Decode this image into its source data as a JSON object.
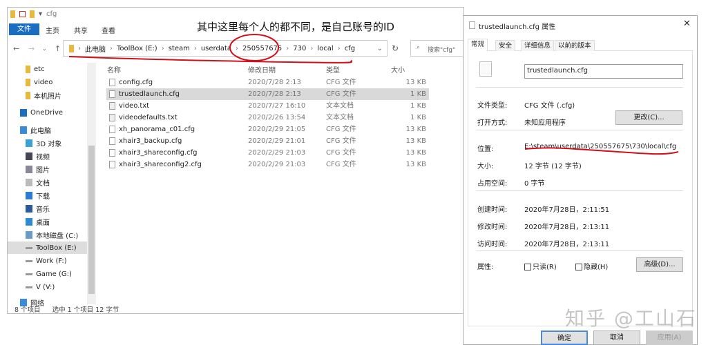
{
  "explorer": {
    "title": "cfg",
    "ribbon_tabs": [
      "文件",
      "主页",
      "共享",
      "查看"
    ],
    "breadcrumb": [
      "此电脑",
      "ToolBox (E:)",
      "steam",
      "userdata",
      "250557675",
      "730",
      "local",
      "cfg"
    ],
    "search_placeholder": "搜索\"cfg\"",
    "sidebar": [
      "etc",
      "video",
      "本机照片",
      "OneDrive",
      "此电脑",
      "3D 对象",
      "视频",
      "图片",
      "文档",
      "下载",
      "音乐",
      "桌面",
      "本地磁盘 (C:)",
      "ToolBox (E:)",
      "Work (F:)",
      "Game (G:)",
      "V (V:)",
      "网络"
    ],
    "columns": [
      "名称",
      "修改日期",
      "类型",
      "大小"
    ],
    "files": [
      {
        "name": "config.cfg",
        "date": "2020/7/28 2:13",
        "type": "CFG 文件",
        "size": "13 KB"
      },
      {
        "name": "trustedlaunch.cfg",
        "date": "2020/7/28 2:13",
        "type": "CFG 文件",
        "size": "1 KB",
        "selected": true
      },
      {
        "name": "video.txt",
        "date": "2020/7/27 16:10",
        "type": "文本文档",
        "size": "1 KB"
      },
      {
        "name": "videodefaults.txt",
        "date": "2020/2/26 13:54",
        "type": "文本文档",
        "size": "1 KB"
      },
      {
        "name": "xh_panorama_c01.cfg",
        "date": "2020/2/29 21:05",
        "type": "CFG 文件",
        "size": "13 KB"
      },
      {
        "name": "xhair3_backup.cfg",
        "date": "2020/2/29 21:01",
        "type": "CFG 文件",
        "size": "13 KB"
      },
      {
        "name": "xhair3_shareconfig.cfg",
        "date": "2020/2/29 21:03",
        "type": "CFG 文件",
        "size": "13 KB"
      },
      {
        "name": "xhair3_shareconfig2.cfg",
        "date": "2020/2/29 21:03",
        "type": "CFG 文件",
        "size": "13 KB"
      }
    ],
    "status": {
      "count": "8 个项目",
      "selected": "选中 1 个项目  12 字节"
    }
  },
  "annotation": "其中这里每个人的都不同，是自己账号的ID",
  "dialog": {
    "title": "trustedlaunch.cfg 属性",
    "tabs": [
      "常规",
      "安全",
      "详细信息",
      "以前的版本"
    ],
    "filename": "trustedlaunch.cfg",
    "fields": [
      {
        "label": "文件类型:",
        "value": "CFG 文件 (.cfg)"
      },
      {
        "label": "打开方式:",
        "value": "未知应用程序"
      },
      {
        "label": "位置:",
        "value": "E:\\steam\\userdata\\250557675\\730\\local\\cfg"
      },
      {
        "label": "大小:",
        "value": "12 字节 (12 字节)"
      },
      {
        "label": "占用空间:",
        "value": "0 字节"
      },
      {
        "label": "创建时间:",
        "value": "2020年7月28日，2:11:51"
      },
      {
        "label": "修改时间:",
        "value": "2020年7月28日，2:13:11"
      },
      {
        "label": "访问时间:",
        "value": "2020年7月28日，2:13:11"
      }
    ],
    "attr_label": "属性:",
    "readonly": "只读(R)",
    "hidden": "隐藏(H)",
    "change_btn": "更改(C)...",
    "advanced_btn": "高级(D)...",
    "ok": "确定",
    "cancel": "取消",
    "apply": "应用(A)"
  },
  "watermark": "知乎 @工山石",
  "colors": {
    "accent": "#1a6dc0",
    "annotation": "#d0101a"
  }
}
